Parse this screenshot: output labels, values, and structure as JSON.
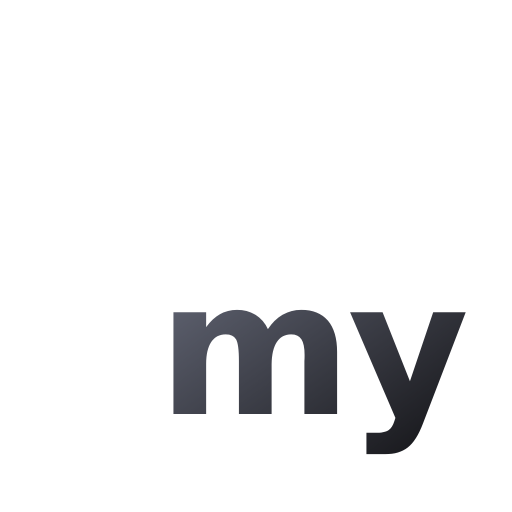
{
  "logo": {
    "text": "my",
    "gradient": {
      "start_color": "#6b6f7f",
      "end_color": "#111114"
    }
  }
}
